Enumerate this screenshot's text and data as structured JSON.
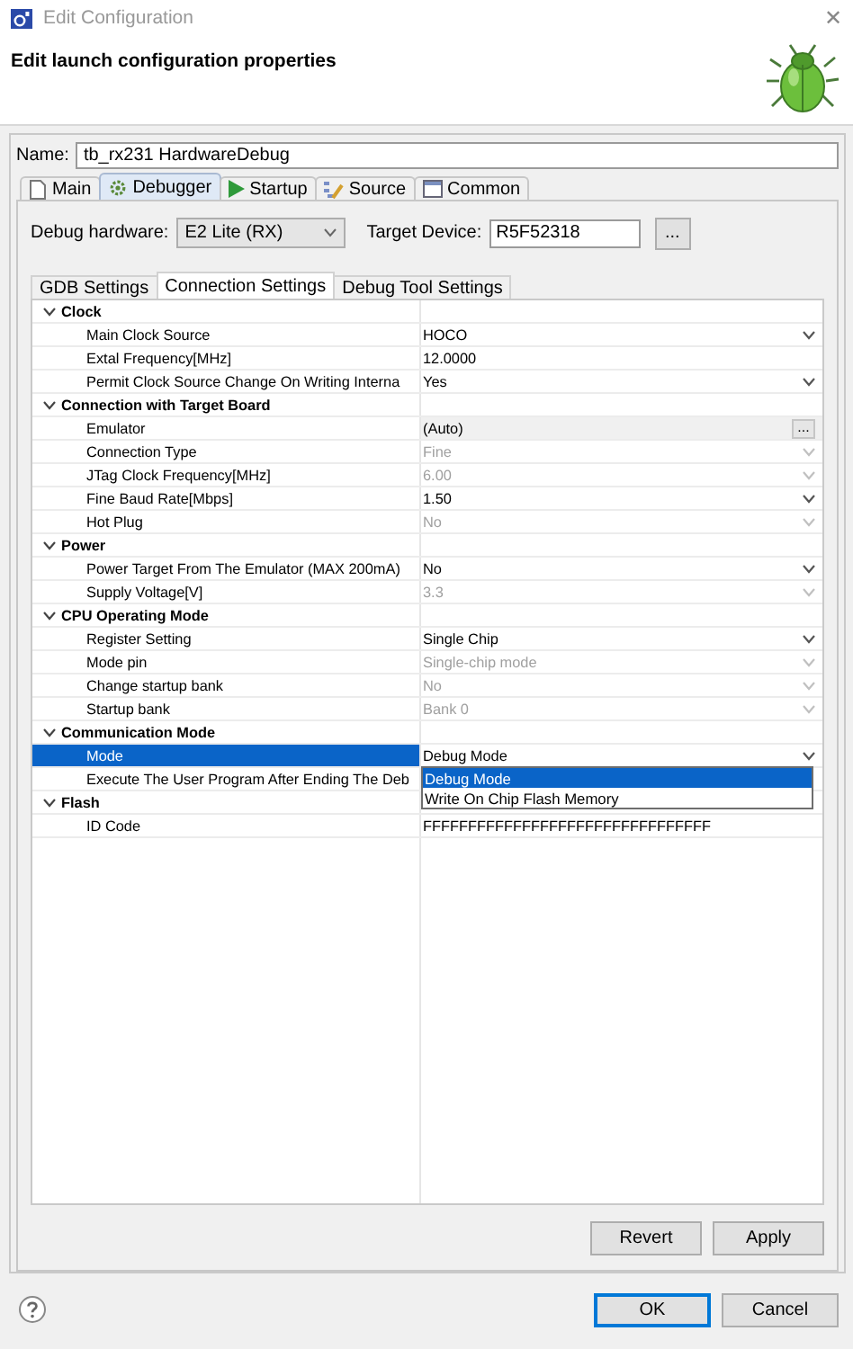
{
  "window": {
    "title": "Edit Configuration",
    "close": "✕"
  },
  "header": {
    "title": "Edit launch configuration properties"
  },
  "name_field": {
    "label": "Name:",
    "value": "tb_rx231 HardwareDebug"
  },
  "tabs": [
    {
      "label": "Main",
      "selected": false
    },
    {
      "label": "Debugger",
      "selected": true
    },
    {
      "label": "Startup",
      "selected": false
    },
    {
      "label": "Source",
      "selected": false
    },
    {
      "label": "Common",
      "selected": false
    }
  ],
  "debug_hardware": {
    "label": "Debug hardware:",
    "value": "E2 Lite (RX)"
  },
  "target_device": {
    "label": "Target Device:",
    "value": "R5F52318",
    "browse": "..."
  },
  "subtabs": [
    {
      "label": "GDB Settings",
      "selected": false
    },
    {
      "label": "Connection Settings",
      "selected": true
    },
    {
      "label": "Debug Tool Settings",
      "selected": false
    }
  ],
  "properties": [
    {
      "group": "Clock",
      "expanded": true,
      "children": [
        {
          "name": "Main Clock Source",
          "value": "HOCO",
          "kind": "dropdown",
          "disabled": false,
          "selected": false
        },
        {
          "name": "Extal Frequency[MHz]",
          "value": "12.0000",
          "kind": "text",
          "disabled": false,
          "selected": false
        },
        {
          "name": "Permit Clock Source Change On Writing Interna",
          "value": "Yes",
          "kind": "dropdown",
          "disabled": false,
          "selected": false
        }
      ]
    },
    {
      "group": "Connection with Target Board",
      "expanded": true,
      "children": [
        {
          "name": "Emulator",
          "value": "(Auto)",
          "kind": "browse",
          "browse": "...",
          "disabled": false,
          "selected": false
        },
        {
          "name": "Connection Type",
          "value": "Fine",
          "kind": "dropdown",
          "disabled": true,
          "selected": false
        },
        {
          "name": "JTag Clock Frequency[MHz]",
          "value": "6.00",
          "kind": "dropdown",
          "disabled": true,
          "selected": false
        },
        {
          "name": "Fine Baud Rate[Mbps]",
          "value": "1.50",
          "kind": "dropdown",
          "disabled": false,
          "selected": false
        },
        {
          "name": "Hot Plug",
          "value": "No",
          "kind": "dropdown",
          "disabled": true,
          "selected": false
        }
      ]
    },
    {
      "group": "Power",
      "expanded": true,
      "children": [
        {
          "name": "Power Target From The Emulator (MAX 200mA)",
          "value": "No",
          "kind": "dropdown",
          "disabled": false,
          "selected": false
        },
        {
          "name": "Supply Voltage[V]",
          "value": "3.3",
          "kind": "dropdown",
          "disabled": true,
          "selected": false
        }
      ]
    },
    {
      "group": "CPU Operating Mode",
      "expanded": true,
      "children": [
        {
          "name": "Register Setting",
          "value": "Single Chip",
          "kind": "dropdown",
          "disabled": false,
          "selected": false
        },
        {
          "name": "Mode pin",
          "value": "Single-chip mode",
          "kind": "dropdown",
          "disabled": true,
          "selected": false
        },
        {
          "name": "Change startup bank",
          "value": "No",
          "kind": "dropdown",
          "disabled": true,
          "selected": false
        },
        {
          "name": "Startup bank",
          "value": "Bank 0",
          "kind": "dropdown",
          "disabled": true,
          "selected": false
        }
      ]
    },
    {
      "group": "Communication Mode",
      "expanded": true,
      "children": [
        {
          "name": "Mode",
          "value": "Debug Mode",
          "kind": "dropdown",
          "disabled": false,
          "selected": true
        },
        {
          "name": "Execute The User Program After Ending The Deb",
          "kind": "hidden",
          "selected": false
        }
      ]
    },
    {
      "group": "Flash",
      "expanded": true,
      "children": [
        {
          "name": "ID Code",
          "value": "FFFFFFFFFFFFFFFFFFFFFFFFFFFFFFFF",
          "kind": "text",
          "disabled": false,
          "selected": false
        }
      ]
    }
  ],
  "dropdown_list": {
    "options": [
      {
        "label": "Debug Mode",
        "selected": true
      },
      {
        "label": "Write On Chip Flash Memory",
        "selected": false
      }
    ]
  },
  "panel_buttons": [
    {
      "label": "Revert"
    },
    {
      "label": "Apply"
    }
  ],
  "dialog_buttons": [
    {
      "label": "OK",
      "default": true
    },
    {
      "label": "Cancel",
      "default": false
    }
  ]
}
